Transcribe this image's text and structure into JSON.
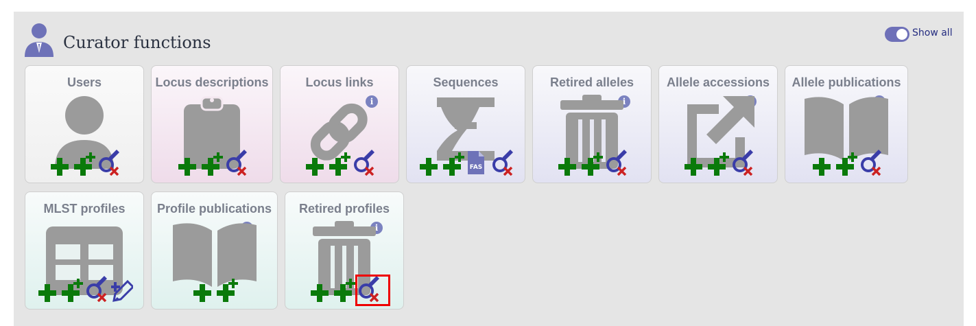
{
  "header": {
    "title": "Curator functions",
    "icon": "user-icon"
  },
  "toggle": {
    "label": "Show all",
    "on": true
  },
  "colors": {
    "accent": "#6e70b8",
    "add": "#0a7a0a",
    "delete": "#cc2222",
    "query": "#3a3da8",
    "highlight": "#ee0000"
  },
  "cards": [
    {
      "title": "Users",
      "icon": "user-icon",
      "info": false,
      "actions": [
        "add",
        "batch-add",
        "query"
      ]
    },
    {
      "title": "Locus descriptions",
      "icon": "clipboard-icon",
      "info": false,
      "actions": [
        "add",
        "batch-add",
        "query"
      ]
    },
    {
      "title": "Locus links",
      "icon": "link-icon",
      "info": true,
      "actions": [
        "add",
        "batch-add",
        "query"
      ]
    },
    {
      "title": "Sequences",
      "icon": "dna-icon",
      "info": false,
      "actions": [
        "add",
        "batch-add",
        "fasta-upload",
        "query"
      ],
      "fasta_label": "FAS"
    },
    {
      "title": "Retired alleles",
      "icon": "trash-icon",
      "info": true,
      "actions": [
        "add",
        "batch-add",
        "query"
      ]
    },
    {
      "title": "Allele accessions",
      "icon": "external-link-icon",
      "info": true,
      "actions": [
        "add",
        "batch-add",
        "query"
      ]
    },
    {
      "title": "Allele publications",
      "icon": "book-icon",
      "info": true,
      "actions": [
        "add",
        "batch-add",
        "query"
      ]
    },
    {
      "title": "MLST profiles",
      "icon": "table-icon",
      "info": false,
      "actions": [
        "add",
        "batch-add",
        "query",
        "batch-update"
      ]
    },
    {
      "title": "Profile publications",
      "icon": "book-icon",
      "info": true,
      "actions": [
        "add",
        "batch-add"
      ]
    },
    {
      "title": "Retired profiles",
      "icon": "trash-icon",
      "info": true,
      "actions": [
        "add",
        "batch-add",
        "query"
      ]
    }
  ]
}
